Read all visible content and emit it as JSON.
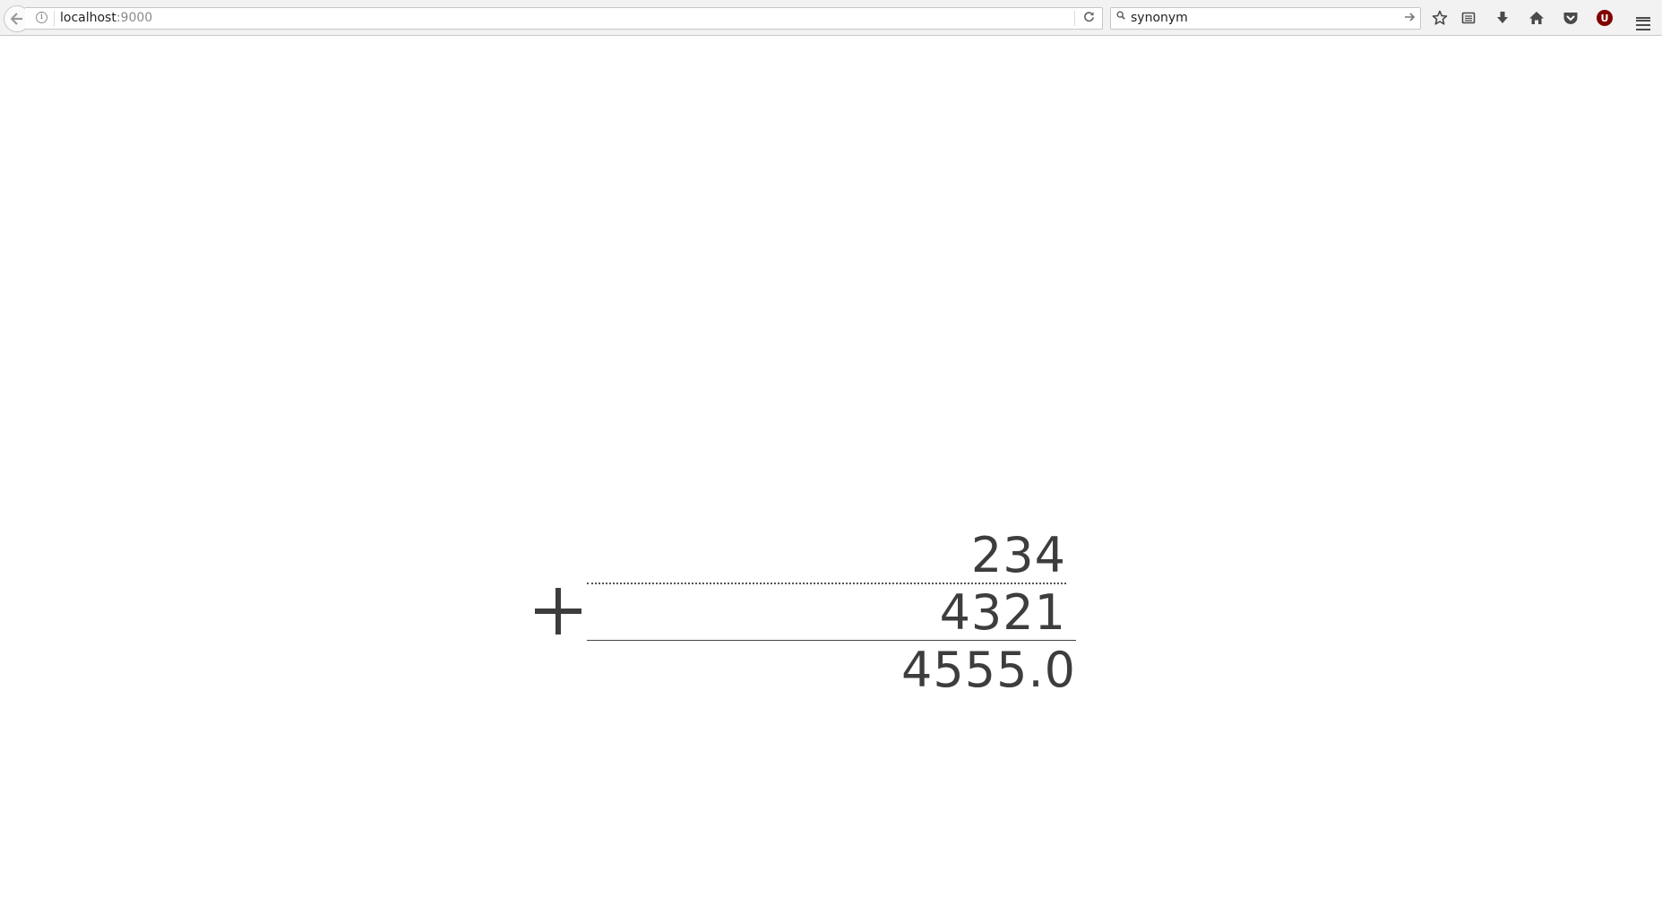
{
  "browser": {
    "url_host": "localhost",
    "url_port": ":9000",
    "search_query": "synonym"
  },
  "toolbar": {
    "icons": [
      "back-icon",
      "info-icon",
      "reload-icon",
      "search-icon",
      "go-arrow-icon",
      "bookmark-star-icon",
      "reading-list-icon",
      "download-icon",
      "home-icon",
      "pocket-icon",
      "ublock-icon",
      "menu-icon"
    ],
    "ublock_label": "U",
    "ublock_color": "#800000"
  },
  "calculation": {
    "operator": "+",
    "operand_1": "234",
    "operand_2": "4321",
    "result": "4555.0"
  }
}
